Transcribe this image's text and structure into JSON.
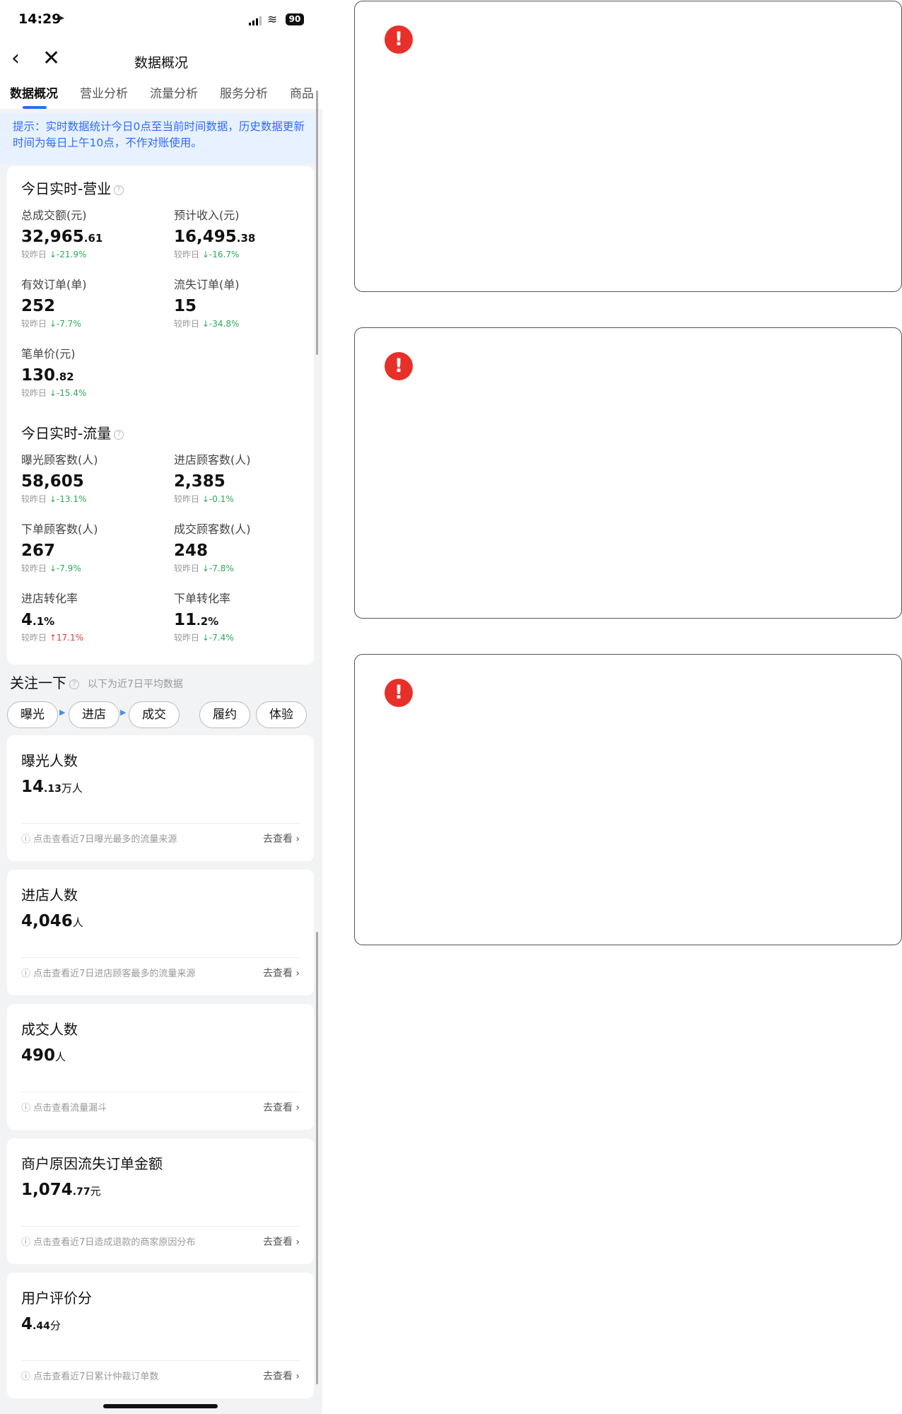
{
  "status_bar": {
    "time": "14:29",
    "battery": "90"
  },
  "nav": {
    "title": "数据概况",
    "back_icon": "‹",
    "close_icon": "✕"
  },
  "tabs": [
    "数据概况",
    "营业分析",
    "流量分析",
    "服务分析",
    "商品"
  ],
  "tip": "提示：实时数据统计今日0点至当前时间数据，历史数据更新时间为每日上午10点，不作对账使用。",
  "realtime_business": {
    "title": "今日实时-营业",
    "metrics": [
      {
        "label": "总成交额(元)",
        "int": "32,965",
        "dec": ".61",
        "cmp_label": "较昨日",
        "cmp": "-21.9%",
        "dir": "down"
      },
      {
        "label": "预计收入(元)",
        "int": "16,495",
        "dec": ".38",
        "cmp_label": "较昨日",
        "cmp": "-16.7%",
        "dir": "down"
      },
      {
        "label": "有效订单(单)",
        "int": "252",
        "dec": "",
        "cmp_label": "较昨日",
        "cmp": "-7.7%",
        "dir": "down"
      },
      {
        "label": "流失订单(单)",
        "int": "15",
        "dec": "",
        "cmp_label": "较昨日",
        "cmp": "-34.8%",
        "dir": "down"
      },
      {
        "label": "笔单价(元)",
        "int": "130",
        "dec": ".82",
        "cmp_label": "较昨日",
        "cmp": "-15.4%",
        "dir": "down"
      }
    ]
  },
  "realtime_traffic": {
    "title": "今日实时-流量",
    "metrics": [
      {
        "label": "曝光顾客数(人)",
        "int": "58,605",
        "dec": "",
        "cmp_label": "较昨日",
        "cmp": "-13.1%",
        "dir": "down"
      },
      {
        "label": "进店顾客数(人)",
        "int": "2,385",
        "dec": "",
        "cmp_label": "较昨日",
        "cmp": "-0.1%",
        "dir": "down"
      },
      {
        "label": "下单顾客数(人)",
        "int": "267",
        "dec": "",
        "cmp_label": "较昨日",
        "cmp": "-7.9%",
        "dir": "down"
      },
      {
        "label": "成交顾客数(人)",
        "int": "248",
        "dec": "",
        "cmp_label": "较昨日",
        "cmp": "-7.8%",
        "dir": "down"
      },
      {
        "label": "进店转化率",
        "int": "4",
        "dec": ".1%",
        "cmp_label": "较昨日",
        "cmp": "17.1%",
        "dir": "up"
      },
      {
        "label": "下单转化率",
        "int": "11",
        "dec": ".2%",
        "cmp_label": "较昨日",
        "cmp": "-7.4%",
        "dir": "down"
      }
    ]
  },
  "focus": {
    "title": "关注一下",
    "subtitle": "以下为近7日平均数据",
    "pills": [
      "曝光",
      "进店",
      "成交",
      "履约",
      "体验"
    ],
    "cards": [
      {
        "title": "曝光人数",
        "int": "14",
        "dec": ".13",
        "unit": "万人",
        "note": "点击查看近7日曝光最多的流量来源",
        "link": "去查看"
      },
      {
        "title": "进店人数",
        "int": "4,046",
        "dec": "",
        "unit": "人",
        "note": "点击查看近7日进店顾客最多的流量来源",
        "link": "去查看"
      },
      {
        "title": "成交人数",
        "int": "490",
        "dec": "",
        "unit": "人",
        "note": "点击查看流量漏斗",
        "link": "去查看"
      },
      {
        "title": "商户原因流失订单金额",
        "int": "1,074",
        "dec": ".77",
        "unit": "元",
        "note": "点击查看近7日造成退款的商家原因分布",
        "link": "去查看"
      },
      {
        "title": "用户评价分",
        "int": "4",
        "dec": ".44",
        "unit": "分",
        "note": "点击查看近7日累计仲裁订单数",
        "link": "去查看"
      }
    ]
  },
  "placeholders": [
    {
      "icon": "!"
    },
    {
      "icon": "!"
    },
    {
      "icon": "!"
    }
  ],
  "colors": {
    "accent": "#2f6bff",
    "down": "#2fa85a",
    "up": "#e23b3b",
    "error": "#e8302a"
  }
}
